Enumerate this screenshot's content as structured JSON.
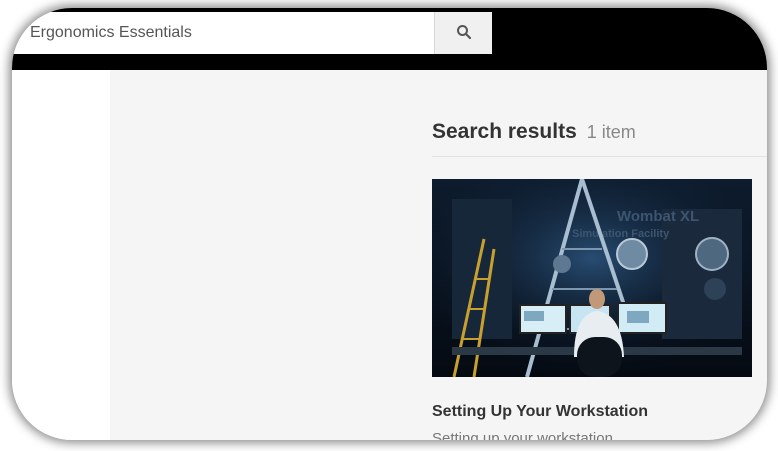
{
  "search": {
    "query": "Ergonomics Essentials",
    "button_icon": "search-icon"
  },
  "results": {
    "title": "Search results",
    "count": "1 item",
    "items": [
      {
        "title": "Setting Up Your Workstation",
        "description": "Setting up your workstation",
        "thumbnail_sign": "Wombat XL",
        "thumbnail_sign2": "Simulation Facility"
      }
    ]
  },
  "colors": {
    "topbar": "#000000",
    "content_bg": "#f5f5f5",
    "title_text": "#333333",
    "muted_text": "#888888"
  }
}
